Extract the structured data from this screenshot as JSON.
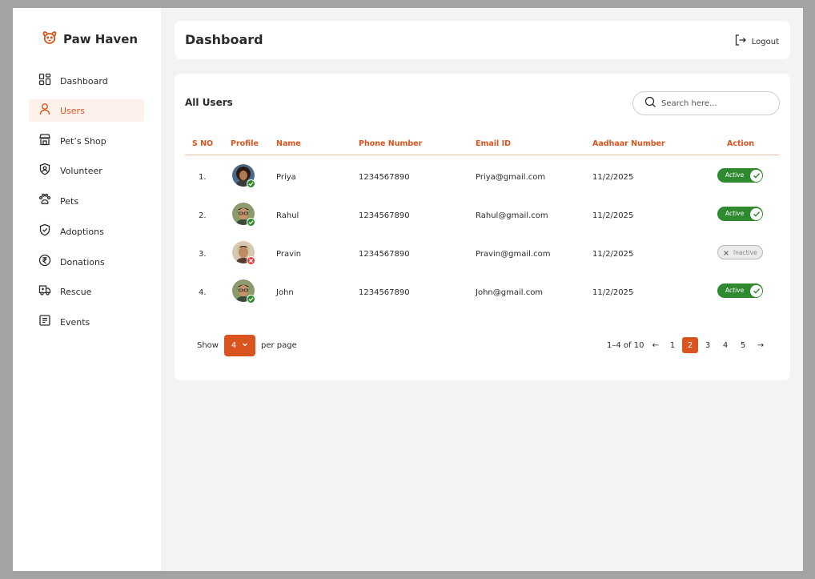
{
  "brand": {
    "name": "Paw Haven",
    "icon": "paw-face-icon",
    "accent": "#d9541e"
  },
  "sidebar": {
    "items": [
      {
        "label": "Dashboard",
        "icon": "grid-icon",
        "active": false
      },
      {
        "label": "Users",
        "icon": "user-icon",
        "active": true
      },
      {
        "label": "Pet’s Shop",
        "icon": "shop-icon",
        "active": false
      },
      {
        "label": "Volunteer",
        "icon": "volunteer-icon",
        "active": false
      },
      {
        "label": "Pets",
        "icon": "paw-icon",
        "active": false
      },
      {
        "label": "Adoptions",
        "icon": "shield-check-icon",
        "active": false
      },
      {
        "label": "Donations",
        "icon": "rupee-icon",
        "active": false
      },
      {
        "label": "Rescue",
        "icon": "truck-icon",
        "active": false
      },
      {
        "label": "Events",
        "icon": "list-icon",
        "active": false
      }
    ]
  },
  "header": {
    "title": "Dashboard",
    "logout_label": "Logout"
  },
  "users": {
    "title": "All Users",
    "search_placeholder": "Search here...",
    "columns": [
      "S NO",
      "Profile",
      "Name",
      "Phone Number",
      "Email ID",
      "Aadhaar Number",
      "Action"
    ],
    "rows": [
      {
        "sno": "1.",
        "name": "Priya",
        "phone": "1234567890",
        "email": "Priya@gmail.com",
        "aadhaar": "11/2/2025",
        "status": "Active",
        "verified": true
      },
      {
        "sno": "2.",
        "name": "Rahul",
        "phone": "1234567890",
        "email": "Rahul@gmail.com",
        "aadhaar": "11/2/2025",
        "status": "Active",
        "verified": true
      },
      {
        "sno": "3.",
        "name": "Pravin",
        "phone": "1234567890",
        "email": "Pravin@gmail.com",
        "aadhaar": "11/2/2025",
        "status": "Inactive",
        "verified": false
      },
      {
        "sno": "4.",
        "name": "John",
        "phone": "1234567890",
        "email": "John@gmail.com",
        "aadhaar": "11/2/2025",
        "status": "Active",
        "verified": true
      }
    ]
  },
  "pagination": {
    "show_label": "Show",
    "per_page_value": "4",
    "per_page_label": "per page",
    "range": "1–4 of 10",
    "prev": "←",
    "next": "→",
    "pages": [
      "1",
      "2",
      "3",
      "4",
      "5"
    ],
    "current_page": "2"
  },
  "colors": {
    "active_green": "#2f8a2f",
    "inactive_red": "#e53935",
    "header_orange": "#d9541e"
  }
}
